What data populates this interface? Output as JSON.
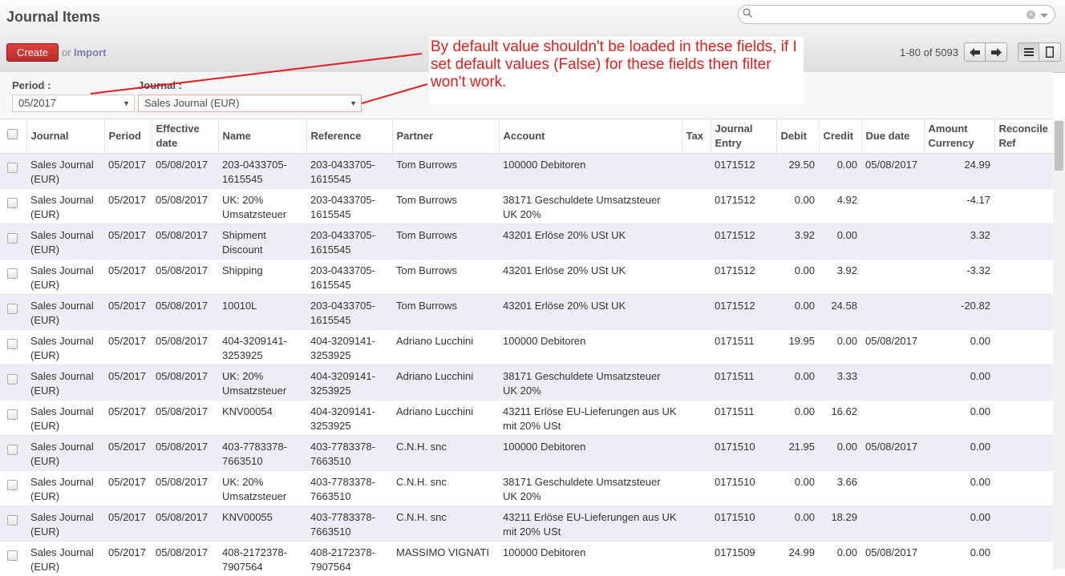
{
  "header": {
    "title": "Journal Items",
    "search": {
      "value": "",
      "placeholder": ""
    },
    "create_label": "Create",
    "or_text": "or",
    "import_label": "Import",
    "pager_text": "1-80 of 5093"
  },
  "filters": {
    "period_label": "Period :",
    "period_value": "05/2017",
    "journal_label": "Journal :",
    "journal_value": "Sales Journal (EUR)"
  },
  "annotation": {
    "text": "By default value shouldn't be loaded in these fields, if I set default values (False) for these fields then filter won't work.",
    "color": "#e02020"
  },
  "table": {
    "columns": [
      "Journal",
      "Period",
      "Effective date",
      "Name",
      "Reference",
      "Partner",
      "Account",
      "Tax",
      "Journal Entry",
      "Debit",
      "Credit",
      "Due date",
      "Amount Currency",
      "Reconcile Ref"
    ],
    "rows": [
      [
        "Sales Journal (EUR)",
        "05/2017",
        "05/08/2017",
        "203-0433705-1615545",
        "203-0433705-1615545",
        "Tom Burrows",
        "100000 Debitoren",
        "",
        "0171512",
        "29.50",
        "0.00",
        "05/08/2017",
        "24.99",
        ""
      ],
      [
        "Sales Journal (EUR)",
        "05/2017",
        "05/08/2017",
        "UK: 20% Umsatzsteuer",
        "203-0433705-1615545",
        "Tom Burrows",
        "38171 Geschuldete Umsatzsteuer UK 20%",
        "",
        "0171512",
        "0.00",
        "4.92",
        "",
        "-4.17",
        ""
      ],
      [
        "Sales Journal (EUR)",
        "05/2017",
        "05/08/2017",
        "Shipment Discount",
        "203-0433705-1615545",
        "Tom Burrows",
        "43201 Erlöse 20% USt UK",
        "",
        "0171512",
        "3.92",
        "0.00",
        "",
        "3.32",
        ""
      ],
      [
        "Sales Journal (EUR)",
        "05/2017",
        "05/08/2017",
        "Shipping",
        "203-0433705-1615545",
        "Tom Burrows",
        "43201 Erlöse 20% USt UK",
        "",
        "0171512",
        "0.00",
        "3.92",
        "",
        "-3.32",
        ""
      ],
      [
        "Sales Journal (EUR)",
        "05/2017",
        "05/08/2017",
        "10010L",
        "203-0433705-1615545",
        "Tom Burrows",
        "43201 Erlöse 20% USt UK",
        "",
        "0171512",
        "0.00",
        "24.58",
        "",
        "-20.82",
        ""
      ],
      [
        "Sales Journal (EUR)",
        "05/2017",
        "05/08/2017",
        "404-3209141-3253925",
        "404-3209141-3253925",
        "Adriano Lucchini",
        "100000 Debitoren",
        "",
        "0171511",
        "19.95",
        "0.00",
        "05/08/2017",
        "0.00",
        ""
      ],
      [
        "Sales Journal (EUR)",
        "05/2017",
        "05/08/2017",
        "UK: 20% Umsatzsteuer",
        "404-3209141-3253925",
        "Adriano Lucchini",
        "38171 Geschuldete Umsatzsteuer UK 20%",
        "",
        "0171511",
        "0.00",
        "3.33",
        "",
        "0.00",
        ""
      ],
      [
        "Sales Journal (EUR)",
        "05/2017",
        "05/08/2017",
        "KNV00054",
        "404-3209141-3253925",
        "Adriano Lucchini",
        "43211 Erlöse EU-Lieferungen aus UK mit 20% USt",
        "",
        "0171511",
        "0.00",
        "16.62",
        "",
        "0.00",
        ""
      ],
      [
        "Sales Journal (EUR)",
        "05/2017",
        "05/08/2017",
        "403-7783378-7663510",
        "403-7783378-7663510",
        "C.N.H. snc",
        "100000 Debitoren",
        "",
        "0171510",
        "21.95",
        "0.00",
        "05/08/2017",
        "0.00",
        ""
      ],
      [
        "Sales Journal (EUR)",
        "05/2017",
        "05/08/2017",
        "UK: 20% Umsatzsteuer",
        "403-7783378-7663510",
        "C.N.H. snc",
        "38171 Geschuldete Umsatzsteuer UK 20%",
        "",
        "0171510",
        "0.00",
        "3.66",
        "",
        "0.00",
        ""
      ],
      [
        "Sales Journal (EUR)",
        "05/2017",
        "05/08/2017",
        "KNV00055",
        "403-7783378-7663510",
        "C.N.H. snc",
        "43211 Erlöse EU-Lieferungen aus UK mit 20% USt",
        "",
        "0171510",
        "0.00",
        "18.29",
        "",
        "0.00",
        ""
      ],
      [
        "Sales Journal (EUR)",
        "05/2017",
        "05/08/2017",
        "408-2172378-7907564",
        "408-2172378-7907564",
        "MASSIMO VIGNATI",
        "100000 Debitoren",
        "",
        "0171509",
        "24.99",
        "0.00",
        "05/08/2017",
        "0.00",
        ""
      ]
    ]
  }
}
